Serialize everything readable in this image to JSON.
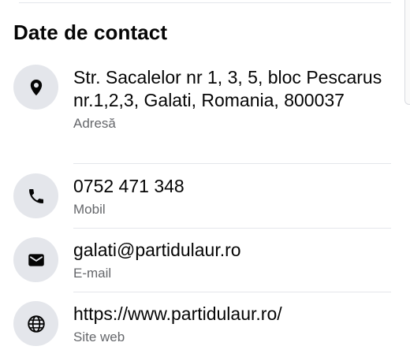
{
  "section": {
    "title": "Date de contact"
  },
  "contact": {
    "address": {
      "value": "Str. Sacalelor nr 1, 3, 5, bloc Pescarus nr.1,2,3, Galati, Romania, 800037",
      "label": "Adresă",
      "icon": "location-pin-icon"
    },
    "phone": {
      "value": "0752 471 348",
      "label": "Mobil",
      "icon": "phone-icon"
    },
    "email": {
      "value": "galati@partidulaur.ro",
      "label": "E-mail",
      "icon": "envelope-icon"
    },
    "website": {
      "value": "https://www.partidulaur.ro/",
      "label": "Site web",
      "icon": "globe-icon"
    }
  },
  "colors": {
    "icon_background": "#e4e6eb",
    "primary_text": "#050505",
    "secondary_text": "#65676b",
    "divider": "#e4e6eb"
  }
}
